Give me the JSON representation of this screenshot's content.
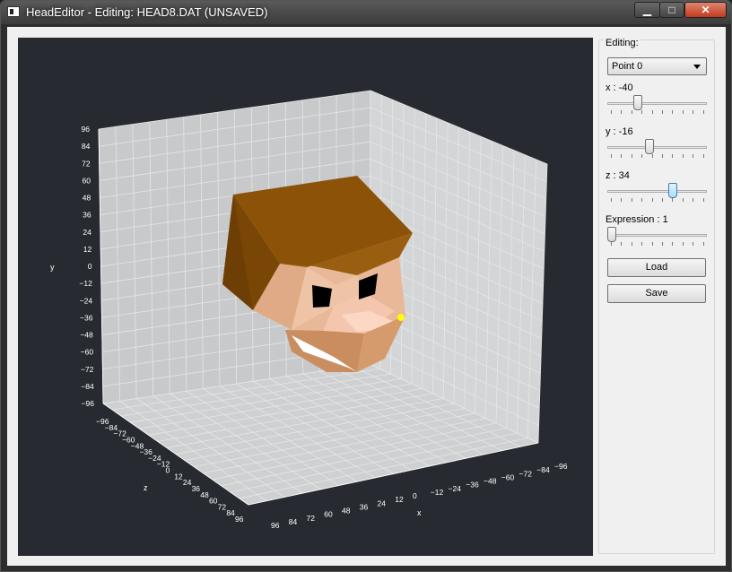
{
  "window": {
    "title": "HeadEditor - Editing: HEAD8.DAT (UNSAVED)",
    "minimize_glyph": "▁",
    "maximize_glyph": "□",
    "close_glyph": "✕"
  },
  "colors": {
    "plot_background": "#272a30",
    "face_skin": "#e8b898",
    "hair": "#8b5208",
    "highlight_point": "#ffff00"
  },
  "plot": {
    "axes": {
      "y": {
        "name": "y",
        "ticks": [
          "96",
          "84",
          "72",
          "60",
          "48",
          "36",
          "24",
          "12",
          "0",
          "−12",
          "−24",
          "−36",
          "−48",
          "−60",
          "−72",
          "−84",
          "−96"
        ]
      },
      "z": {
        "name": "z",
        "ticks": [
          "−96",
          "−84",
          "−72",
          "−60",
          "−48",
          "−36",
          "−24",
          "−12",
          "0",
          "12",
          "24",
          "36",
          "48",
          "60",
          "72",
          "84",
          "96"
        ]
      },
      "x": {
        "name": "x",
        "ticks": [
          "96",
          "84",
          "72",
          "60",
          "48",
          "36",
          "24",
          "12",
          "0",
          "−12",
          "−24",
          "−36",
          "−48",
          "−60",
          "−72",
          "−84",
          "−96"
        ]
      }
    }
  },
  "panel": {
    "group_title": "Editing:",
    "point_select": {
      "value": "Point 0"
    },
    "sliders": [
      {
        "label": "x : -40",
        "value": -40,
        "min": -96,
        "max": 96
      },
      {
        "label": "y : -16",
        "value": -16,
        "min": -96,
        "max": 96
      },
      {
        "label": "z : 34",
        "value": 34,
        "min": -96,
        "max": 96
      },
      {
        "label": "Expression : 1",
        "value": 1,
        "min": 1,
        "max": 10
      }
    ],
    "load_label": "Load",
    "save_label": "Save"
  }
}
